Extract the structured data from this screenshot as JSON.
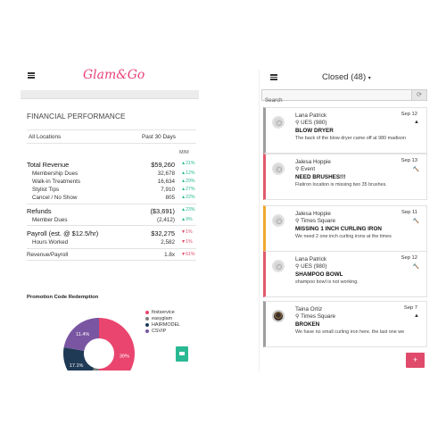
{
  "left": {
    "logo": "Glam&Go",
    "section_title": "FINANCIAL PERFORMANCE",
    "filters": {
      "location": "All Locations",
      "period": "Past 30 Days"
    },
    "mm_header": "M/M",
    "rows": [
      {
        "label": "Total Revenue",
        "value": "$59,260",
        "change": "▲21%",
        "dir": "up",
        "type": "main"
      },
      {
        "label": "Membership Dues",
        "value": "32,678",
        "change": "▲12%",
        "dir": "up",
        "type": "sub"
      },
      {
        "label": "Walk-in Treatments",
        "value": "16,634",
        "change": "▲29%",
        "dir": "up",
        "type": "sub"
      },
      {
        "label": "Stylist Tips",
        "value": "7,910",
        "change": "▲27%",
        "dir": "up",
        "type": "sub"
      },
      {
        "label": "Cancel / No Show",
        "value": "805",
        "change": "▲22%",
        "dir": "up",
        "type": "sub"
      },
      {
        "label": "Refunds",
        "value": "($3,691)",
        "change": "▲23%",
        "dir": "up",
        "type": "main"
      },
      {
        "label": "Member Dues",
        "value": "(2,412)",
        "change": "▲9%",
        "dir": "up",
        "type": "sub"
      },
      {
        "label": "Payroll (est. @ $12.5/hr)",
        "value": "$32,275",
        "change": "▼1%",
        "dir": "down",
        "type": "main"
      },
      {
        "label": "Hours Worked",
        "value": "2,582",
        "change": "▼1%",
        "dir": "down",
        "type": "sub"
      },
      {
        "label": "Revenue/Payroll",
        "value": "1.8x",
        "change": "▼61%",
        "dir": "down",
        "type": "sub-flat"
      }
    ],
    "promo_title": "Promotion Code Redemption",
    "chart_data": {
      "type": "pie",
      "categories": [
        "firstservice",
        "easyglam",
        "HAIRMODEL",
        "CSVIP"
      ],
      "values": [
        39,
        0,
        17.1,
        11.4
      ],
      "labels": [
        "39%",
        "",
        "17.1%",
        "11.4%"
      ],
      "colors": [
        "#e9456e",
        "#7e7e7e",
        "#1f3a55",
        "#7a55a2"
      ]
    },
    "mail_icon": "mail-icon"
  },
  "right": {
    "title": "Closed (48)",
    "title_caret": "▾",
    "search_placeholder": "Search",
    "refresh_icon": "⟳",
    "fab_label": "+",
    "tickets": [
      {
        "name": "Lana Patrick",
        "location": "UES (980)",
        "subject": "BLOW DRYER",
        "body": "The back of the blow dryer came off at 980 madison",
        "date": "Sep 12",
        "flag": "▲",
        "flag_color": "#333",
        "border_color": "#9e9e9e",
        "avatar": "default"
      },
      {
        "name": "Jalesa Hoppie",
        "location": "Event",
        "subject": "NEED BRUSHES!!!",
        "body": "Flatiron location is missing two 35 brushes.",
        "date": "Sep 13",
        "flag": "🔨",
        "flag_color": "#e04a6b",
        "border_color": "#e05a6c",
        "avatar": "default"
      },
      {
        "name": "Jalesa Hoppie",
        "location": "Times Square",
        "subject": "MISSING 1 INCH CURLING IRON",
        "body": "We need 2 one inch curling irons at the times",
        "date": "Sep 11",
        "flag": "🔨",
        "flag_color": "#f0a030",
        "border_color": "#f0a830",
        "avatar": "default"
      },
      {
        "name": "Lana Patrick",
        "location": "UES (980)",
        "subject": "SHAMPOO BOWL",
        "body": "shampoo bowl is not working.",
        "date": "Sep 12",
        "flag": "🔨",
        "flag_color": "#e04a6b",
        "border_color": "#e05a6c",
        "avatar": "default"
      },
      {
        "name": "Taina Ortiz",
        "location": "Times Square",
        "subject": "BROKEN",
        "body": "We have no small curling iron here. the last one we",
        "date": "Sep 7",
        "flag": "▲",
        "flag_color": "#333",
        "border_color": "#9e9e9e",
        "avatar": "photo"
      }
    ]
  }
}
